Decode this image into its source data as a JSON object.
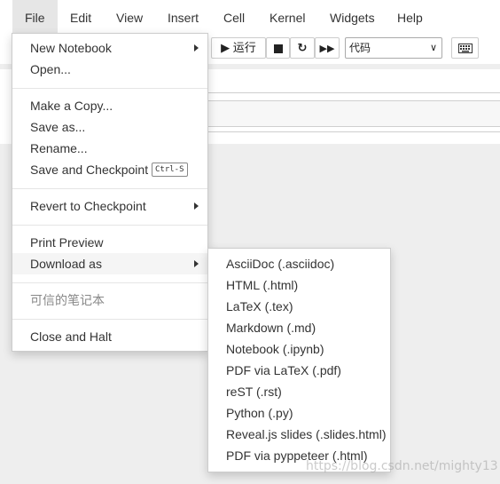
{
  "menubar": {
    "items": [
      "File",
      "Edit",
      "View",
      "Insert",
      "Cell",
      "Kernel",
      "Widgets",
      "Help"
    ]
  },
  "toolbar": {
    "run_label": "运行",
    "cell_type": "代码"
  },
  "file_menu": {
    "new_notebook": "New Notebook",
    "open": "Open...",
    "make_copy": "Make a Copy...",
    "save_as": "Save as...",
    "rename": "Rename...",
    "save_checkpoint": "Save and Checkpoint",
    "save_checkpoint_shortcut": "Ctrl-S",
    "revert_checkpoint": "Revert to Checkpoint",
    "print_preview": "Print Preview",
    "download_as": "Download as",
    "trusted_notebook": "可信的笔记本",
    "close_halt": "Close and Halt"
  },
  "download_menu": {
    "items": [
      "AsciiDoc (.asciidoc)",
      "HTML (.html)",
      "LaTeX (.tex)",
      "Markdown (.md)",
      "Notebook (.ipynb)",
      "PDF via LaTeX (.pdf)",
      "reST (.rst)",
      "Python (.py)",
      "Reveal.js slides (.slides.html)",
      "PDF via pyppeteer (.html)"
    ]
  },
  "watermark": "https://blog.csdn.net/mighty13"
}
